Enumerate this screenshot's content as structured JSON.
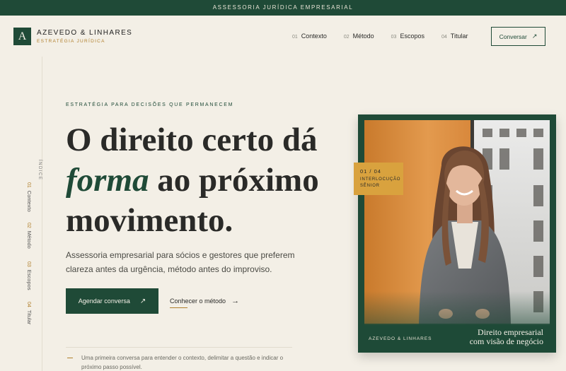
{
  "topbar": {
    "text": "ASSESSORIA JURÍDICA EMPRESARIAL"
  },
  "brand": {
    "logo_letter": "A",
    "name": "AZEVEDO & LINHARES",
    "subtitle": "ESTRATÉGIA JURÍDICA"
  },
  "nav": {
    "items": [
      {
        "num": "01",
        "label": "Contexto"
      },
      {
        "num": "02",
        "label": "Método"
      },
      {
        "num": "03",
        "label": "Escopos"
      },
      {
        "num": "04",
        "label": "Titular"
      }
    ],
    "cta_label": "Conversar"
  },
  "side_index": {
    "label": "ÍNDICE",
    "items": [
      {
        "num": "01",
        "label": "Contexto"
      },
      {
        "num": "02",
        "label": "Método"
      },
      {
        "num": "03",
        "label": "Escopos"
      },
      {
        "num": "04",
        "label": "Titular"
      }
    ]
  },
  "hero": {
    "eyebrow": "ESTRATÉGIA PARA DECISÕES QUE PERMANECEM",
    "headline_line1": "O direito certo dá",
    "headline_em": "forma",
    "headline_line2_rest": " ao próximo",
    "headline_line3": "movimento.",
    "lead": "Assessoria empresarial para sócios e gestores que preferem clareza antes da urgência, método antes do improviso.",
    "primary_button": "Agendar conversa",
    "secondary_link": "Conhecer o método",
    "note": "Uma primeira conversa para entender o contexto, delimitar a questão e indicar o próximo passo possível."
  },
  "card": {
    "badge_num": "01 / 04",
    "badge_label_line1": "INTERLOCUÇÃO",
    "badge_label_line2": "SÊNIOR",
    "brand": "AZEVEDO & LINHARES",
    "caption_line1": "Direito empresarial",
    "caption_line2": "com visão de negócio"
  },
  "colors": {
    "brand_green": "#1f4a37",
    "accent_gold": "#b07f2c",
    "badge_gold": "#d9a23e",
    "background": "#f3efe6"
  },
  "icons": {
    "arrow_up_right": "arrow-up-right-icon",
    "arrow_right": "arrow-right-icon"
  }
}
